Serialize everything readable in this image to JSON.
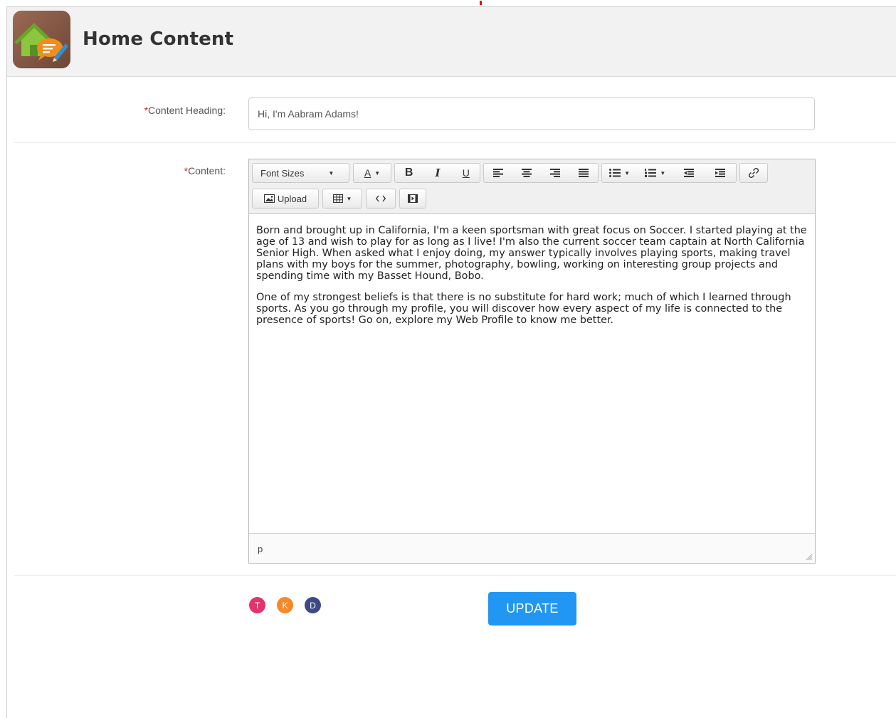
{
  "header": {
    "title": "Home Content",
    "icon": "home-chat-edit-icon"
  },
  "form": {
    "heading": {
      "required_mark": "*",
      "label": "Content Heading:",
      "value": "Hi, I'm Aabram Adams!"
    },
    "content": {
      "required_mark": "*",
      "label": "Content:"
    }
  },
  "editor": {
    "toolbar": {
      "font_sizes_label": "Font Sizes",
      "font_color_label": "A",
      "bold_label": "B",
      "italic_label": "I",
      "underline_label": "U",
      "upload_label": "Upload"
    },
    "paragraphs": [
      "Born and brought up in California, I'm a keen sportsman with great focus on Soccer. I started playing at the age of 13 and wish to play for as long as I live! I'm also the current soccer team captain at North California Senior High. When asked what I enjoy doing, my answer typically involves playing sports, making travel plans with my boys for the summer, photography, bowling, working on interesting group projects and spending time with my Basset Hound, Bobo.",
      "One of my strongest beliefs is that there is no substitute for hard work; much of which I learned through sports. As you go through my profile, you will discover how every aspect of my life is connected to the presence of sports! Go on, explore my Web Profile to know me better."
    ],
    "status_path": "p"
  },
  "avatars": [
    {
      "initial": "T",
      "color": "#e0356b"
    },
    {
      "initial": "K",
      "color": "#f5892a"
    },
    {
      "initial": "D",
      "color": "#3d4a86"
    }
  ],
  "actions": {
    "update_label": "UPDATE",
    "update_color": "#2196f3"
  }
}
